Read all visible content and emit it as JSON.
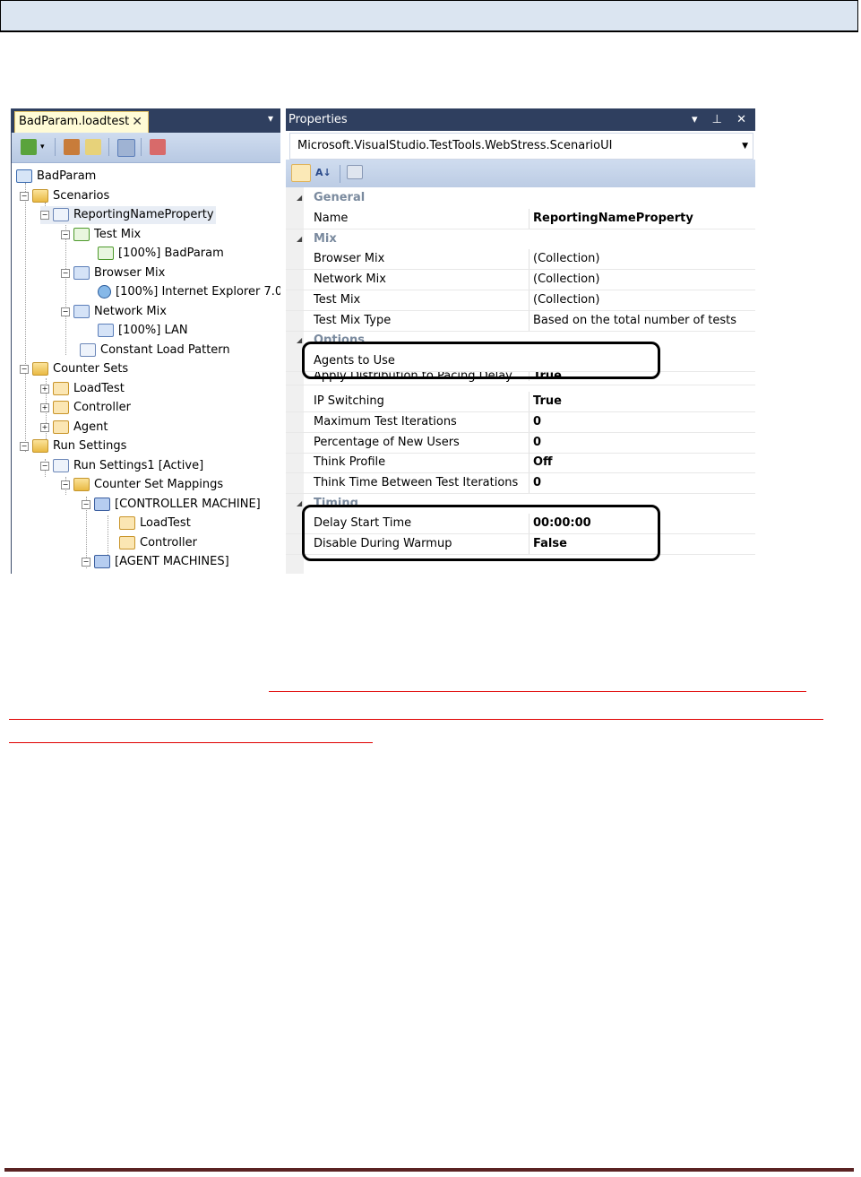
{
  "document_tab": {
    "label": "BadParam.loadtest",
    "close": "✕"
  },
  "tree": {
    "root": "BadParam",
    "scenarios": "Scenarios",
    "scenario": "ReportingNameProperty",
    "test_mix": "Test Mix",
    "test_mix_item": "[100%] BadParam",
    "browser_mix": "Browser Mix",
    "browser_item": "[100%] Internet Explorer 7.0",
    "network_mix": "Network Mix",
    "network_item": "[100%] LAN",
    "load_pattern": "Constant Load Pattern",
    "counter_sets": "Counter Sets",
    "cs_loadtest": "LoadTest",
    "cs_controller": "Controller",
    "cs_agent": "Agent",
    "run_settings": "Run Settings",
    "run_settings1": "Run Settings1 [Active]",
    "counter_set_mappings": "Counter Set Mappings",
    "controller_machine": "[CONTROLLER MACHINE]",
    "map_loadtest": "LoadTest",
    "map_controller": "Controller",
    "agent_machines": "[AGENT MACHINES]"
  },
  "properties": {
    "title": "Properties",
    "controls": "▾ ⊥ ✕",
    "object_selector": "Microsoft.VisualStudio.TestTools.WebStress.ScenarioUI",
    "categories": {
      "general": "General",
      "mix": "Mix",
      "options": "Options",
      "timing": "Timing"
    },
    "rows": {
      "name": {
        "label": "Name",
        "value": "ReportingNameProperty"
      },
      "browser_mix": {
        "label": "Browser Mix",
        "value": "(Collection)"
      },
      "network_mix": {
        "label": "Network Mix",
        "value": "(Collection)"
      },
      "test_mix": {
        "label": "Test Mix",
        "value": "(Collection)"
      },
      "test_mix_type": {
        "label": "Test Mix Type",
        "value": "Based on the total number of tests"
      },
      "agents_to_use": {
        "label": "Agents to Use",
        "value": ""
      },
      "apply_distribution": {
        "label": "Apply Distribution to Pacing Delay",
        "value": "True"
      },
      "ip_switching": {
        "label": "IP Switching",
        "value": "True"
      },
      "max_iterations": {
        "label": "Maximum Test Iterations",
        "value": "0"
      },
      "pct_new_users": {
        "label": "Percentage of New Users",
        "value": "0"
      },
      "think_profile": {
        "label": "Think Profile",
        "value": "Off"
      },
      "think_time_between": {
        "label": "Think Time Between Test Iterations",
        "value": "0"
      },
      "delay_start": {
        "label": "Delay Start Time",
        "value": "00:00:00"
      },
      "disable_warmup": {
        "label": "Disable During Warmup",
        "value": "False"
      }
    }
  },
  "colors": {
    "panel_header": "#2f3f5f",
    "highlight_border": "#000000",
    "red_rule": "#e00000"
  }
}
